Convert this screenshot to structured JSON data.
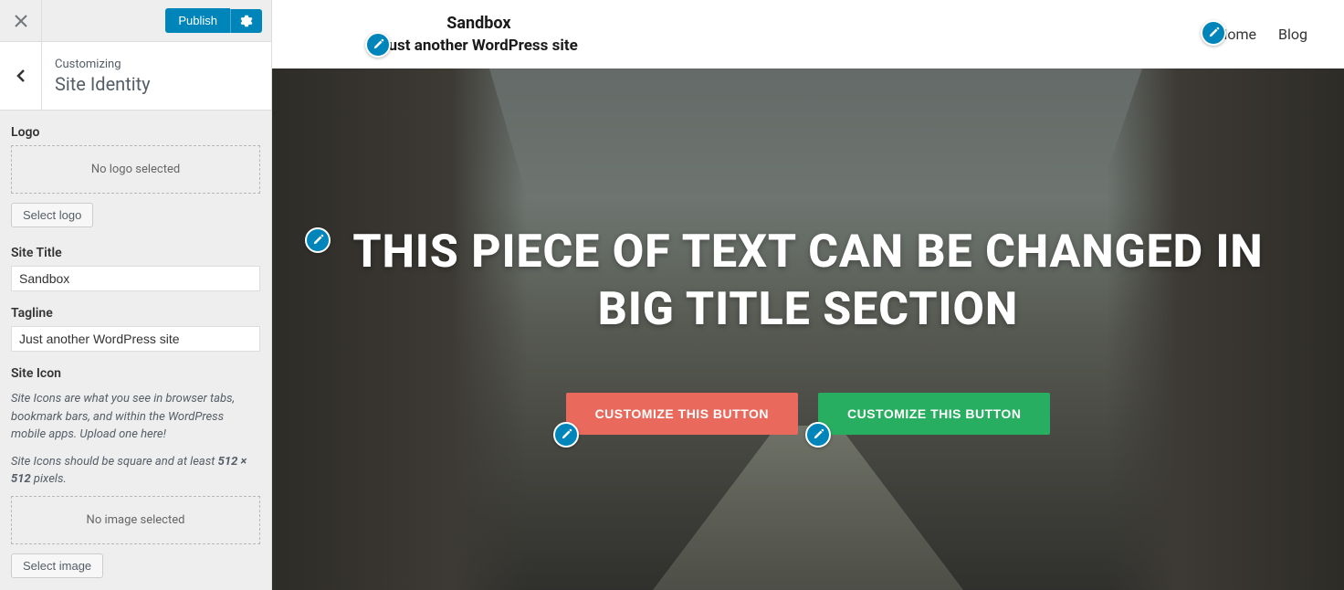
{
  "sidebar": {
    "publish_label": "Publish",
    "customizing_label": "Customizing",
    "panel_title": "Site Identity",
    "logo": {
      "label": "Logo",
      "empty_text": "No logo selected",
      "button_label": "Select logo"
    },
    "site_title": {
      "label": "Site Title",
      "value": "Sandbox"
    },
    "tagline": {
      "label": "Tagline",
      "value": "Just another WordPress site"
    },
    "site_icon": {
      "label": "Site Icon",
      "desc1": "Site Icons are what you see in browser tabs, bookmark bars, and within the WordPress mobile apps. Upload one here!",
      "desc2_prefix": "Site Icons should be square and at least ",
      "desc2_size": "512 × 512",
      "desc2_suffix": " pixels.",
      "empty_text": "No image selected",
      "button_label": "Select image"
    }
  },
  "preview": {
    "site_title": "Sandbox",
    "site_tagline": "Just another WordPress site",
    "nav": {
      "home": "Home",
      "blog": "Blog"
    },
    "hero": {
      "title": "THIS PIECE OF TEXT CAN BE CHANGED IN BIG TITLE SECTION",
      "btn1": "CUSTOMIZE THIS BUTTON",
      "btn2": "CUSTOMIZE THIS BUTTON"
    }
  },
  "colors": {
    "primary": "#0085ba",
    "btn_red": "#e96a5c",
    "btn_green": "#27ae60"
  }
}
